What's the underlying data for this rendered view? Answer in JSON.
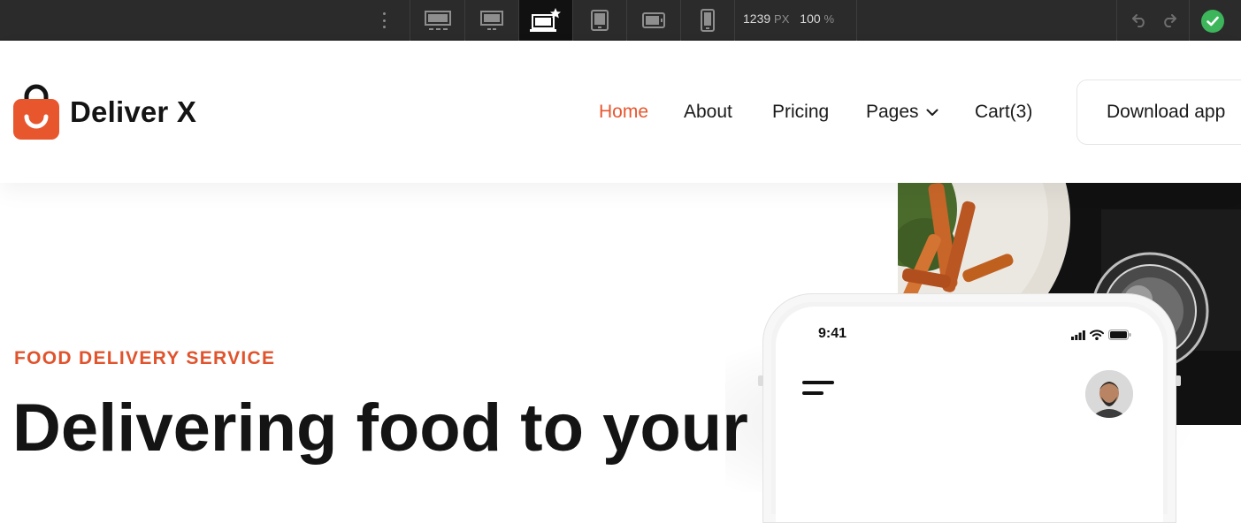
{
  "editor_toolbar": {
    "breakpoints": [
      {
        "name": "desktop-xl-icon",
        "active": false
      },
      {
        "name": "desktop-icon",
        "active": false
      },
      {
        "name": "laptop-base-icon",
        "active": true
      },
      {
        "name": "tablet-icon",
        "active": false
      },
      {
        "name": "mobile-landscape-icon",
        "active": false
      },
      {
        "name": "mobile-portrait-icon",
        "active": false
      }
    ],
    "width_value": "1239",
    "width_unit": "PX",
    "zoom_value": "100",
    "zoom_unit": "%",
    "status_color": "#3cb55b"
  },
  "site": {
    "brand": "Deliver X",
    "brand_color": "#e8562e",
    "nav": {
      "home": "Home",
      "about": "About",
      "pricing": "Pricing",
      "pages": "Pages",
      "cart": "Cart(3)",
      "active": "Home"
    },
    "cta": "Download app"
  },
  "hero": {
    "eyebrow": "FOOD DELIVERY SERVICE",
    "headline": "Delivering food to your",
    "phone": {
      "time": "9:41"
    }
  }
}
